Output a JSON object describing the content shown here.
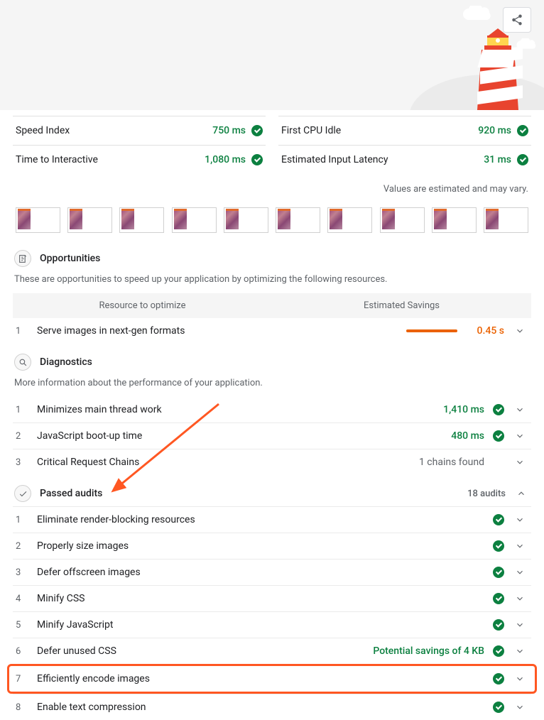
{
  "metrics": [
    [
      {
        "name": "Speed Index",
        "value": "750 ms"
      },
      {
        "name": "First CPU Idle",
        "value": "920 ms"
      }
    ],
    [
      {
        "name": "Time to Interactive",
        "value": "1,080 ms"
      },
      {
        "name": "Estimated Input Latency",
        "value": "31 ms"
      }
    ]
  ],
  "estimate_note": "Values are estimated and may vary.",
  "sections": {
    "opportunities": {
      "title": "Opportunities",
      "desc": "These are opportunities to speed up your application by optimizing the following resources.",
      "col1": "Resource to optimize",
      "col2": "Estimated Savings",
      "items": [
        {
          "n": "1",
          "title": "Serve images in next-gen formats",
          "value": "0.45 s"
        }
      ]
    },
    "diagnostics": {
      "title": "Diagnostics",
      "desc": "More information about the performance of your application.",
      "items": [
        {
          "n": "1",
          "title": "Minimizes main thread work",
          "value": "1,410 ms",
          "green": true,
          "check": true
        },
        {
          "n": "2",
          "title": "JavaScript boot-up time",
          "value": "480 ms",
          "green": true,
          "check": true
        },
        {
          "n": "3",
          "title": "Critical Request Chains",
          "value": "1 chains found",
          "green": false,
          "check": false
        }
      ]
    },
    "passed": {
      "title": "Passed audits",
      "count": "18 audits",
      "items": [
        {
          "n": "1",
          "title": "Eliminate render-blocking resources",
          "value": ""
        },
        {
          "n": "2",
          "title": "Properly size images",
          "value": ""
        },
        {
          "n": "3",
          "title": "Defer offscreen images",
          "value": ""
        },
        {
          "n": "4",
          "title": "Minify CSS",
          "value": ""
        },
        {
          "n": "5",
          "title": "Minify JavaScript",
          "value": ""
        },
        {
          "n": "6",
          "title": "Defer unused CSS",
          "value": "Potential savings of 4 KB"
        },
        {
          "n": "7",
          "title": "Efficiently encode images",
          "value": ""
        },
        {
          "n": "8",
          "title": "Enable text compression",
          "value": ""
        }
      ]
    }
  }
}
